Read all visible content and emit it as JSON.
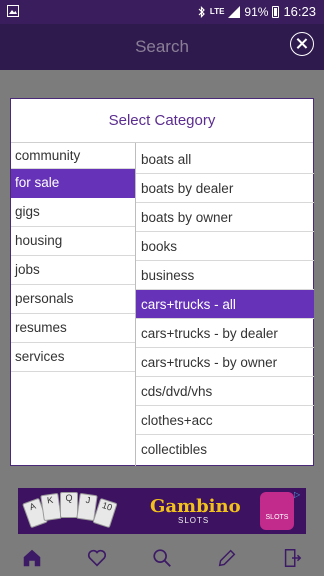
{
  "statusbar": {
    "network": "LTE",
    "battery": "91%",
    "time": "16:23"
  },
  "header": {
    "title": "Search"
  },
  "dialog": {
    "title": "Select Category",
    "left_items": [
      {
        "label": "community",
        "selected": false
      },
      {
        "label": "for sale",
        "selected": true
      },
      {
        "label": "gigs",
        "selected": false
      },
      {
        "label": "housing",
        "selected": false
      },
      {
        "label": "jobs",
        "selected": false
      },
      {
        "label": "personals",
        "selected": false
      },
      {
        "label": "resumes",
        "selected": false
      },
      {
        "label": "services",
        "selected": false
      }
    ],
    "right_items": [
      {
        "label": "boats all",
        "selected": false
      },
      {
        "label": "boats by dealer",
        "selected": false
      },
      {
        "label": "boats by owner",
        "selected": false
      },
      {
        "label": "books",
        "selected": false
      },
      {
        "label": "business",
        "selected": false
      },
      {
        "label": "cars+trucks - all",
        "selected": true
      },
      {
        "label": "cars+trucks - by dealer",
        "selected": false
      },
      {
        "label": "cars+trucks - by owner",
        "selected": false
      },
      {
        "label": "cds/dvd/vhs",
        "selected": false
      },
      {
        "label": "clothes+acc",
        "selected": false
      },
      {
        "label": "collectibles",
        "selected": false
      }
    ]
  },
  "ad": {
    "brand": "Gambino",
    "subtitle": "SLOTS",
    "icon_text": "SLOTS",
    "cards": [
      "A",
      "K",
      "Q",
      "J",
      "10"
    ]
  },
  "bottom_nav": [
    {
      "icon": "home-icon"
    },
    {
      "icon": "heart-icon"
    },
    {
      "icon": "search-icon"
    },
    {
      "icon": "pencil-icon"
    },
    {
      "icon": "exit-icon"
    }
  ],
  "colors": {
    "accent": "#6632b8",
    "header": "#3a1d5c",
    "title_text": "#5b2d90"
  }
}
